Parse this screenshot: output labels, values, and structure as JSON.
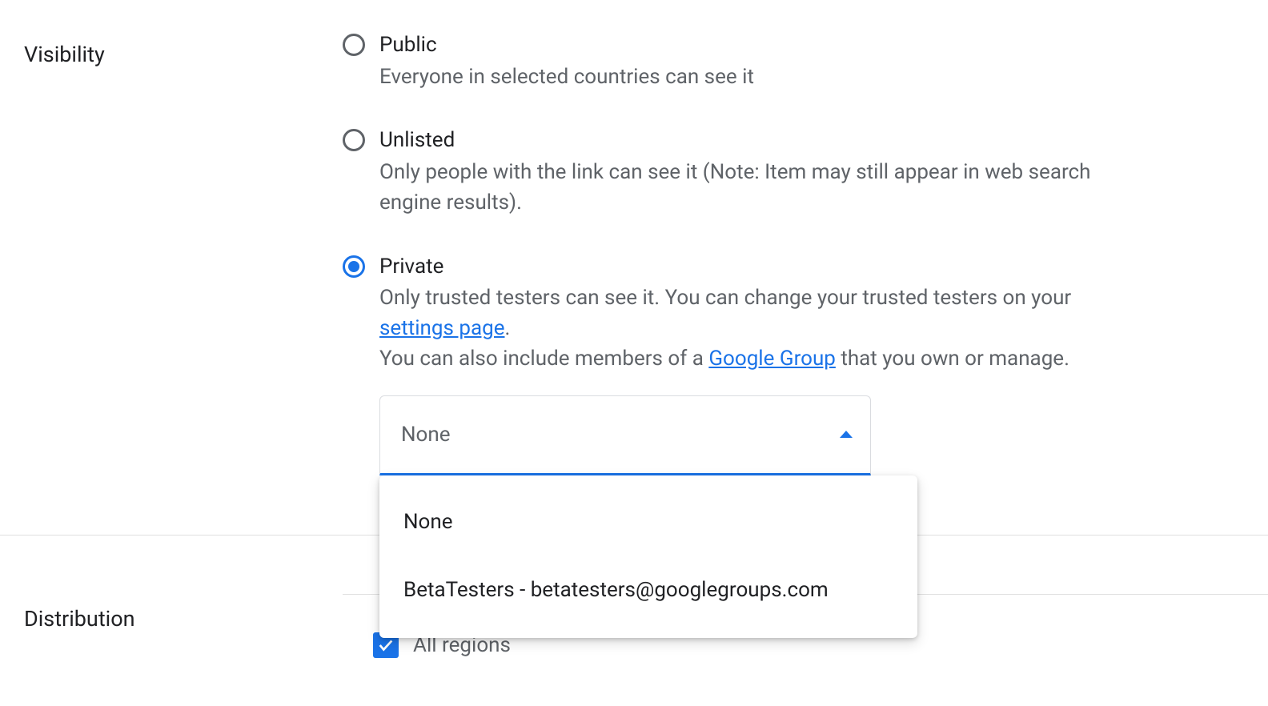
{
  "visibility": {
    "label": "Visibility",
    "options": [
      {
        "title": "Public",
        "desc": "Everyone in selected countries can see it",
        "selected": false
      },
      {
        "title": "Unlisted",
        "desc": "Only people with the link can see it (Note: Item may still appear in web search engine results).",
        "selected": false
      },
      {
        "title": "Private",
        "desc_pre": "Only trusted testers can see it. You can change your trusted testers on your ",
        "settings_link": "settings page",
        "desc_post": ".",
        "desc2_pre": "You can also include members of a ",
        "google_group_link": "Google Group",
        "desc2_post": " that you own or manage.",
        "selected": true
      }
    ],
    "select": {
      "value": "None",
      "options": [
        "None",
        "BetaTesters - betatesters@googlegroups.com"
      ]
    }
  },
  "distribution": {
    "label": "Distribution",
    "all_regions": {
      "label": "All regions",
      "checked": true
    }
  }
}
